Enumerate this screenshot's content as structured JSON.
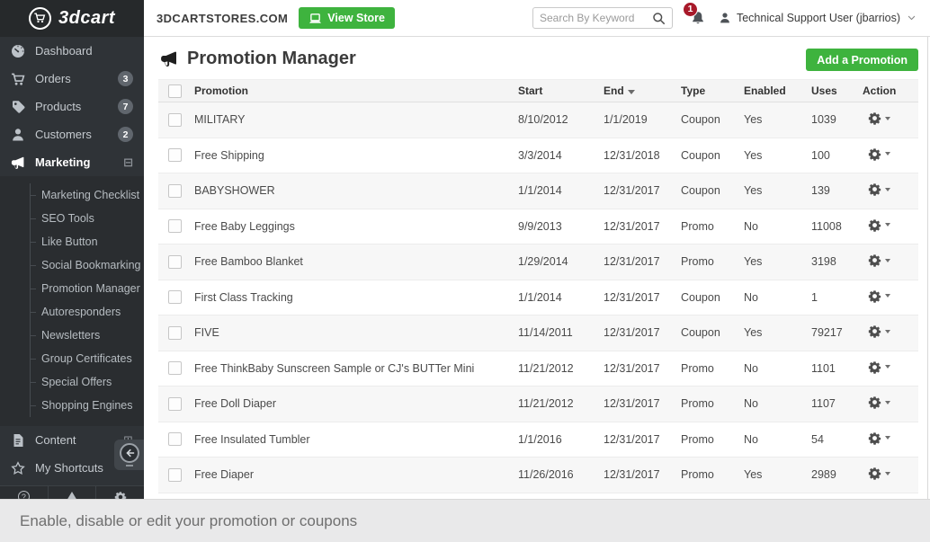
{
  "topbar": {
    "logo_text": "3dcart",
    "store_domain": "3DCARTSTORES.COM",
    "view_store_label": "View Store",
    "search_placeholder": "Search By Keyword",
    "notification_count": "1",
    "user_name": "Technical Support User (jbarrios)"
  },
  "sidebar": {
    "items_top": [
      {
        "label": "Dashboard",
        "icon": "gauge-icon"
      },
      {
        "label": "Orders",
        "icon": "cart-icon",
        "badge": "3"
      },
      {
        "label": "Products",
        "icon": "tags-icon",
        "badge": "7"
      },
      {
        "label": "Customers",
        "icon": "person-icon",
        "badge": "2"
      },
      {
        "label": "Marketing",
        "icon": "megaphone-icon",
        "active": true,
        "expander": "collapse"
      }
    ],
    "submenu": [
      {
        "label": "Marketing Checklist"
      },
      {
        "label": "SEO Tools"
      },
      {
        "label": "Like Button"
      },
      {
        "label": "Social Bookmarking"
      },
      {
        "label": "Promotion Manager"
      },
      {
        "label": "Autoresponders"
      },
      {
        "label": "Newsletters"
      },
      {
        "label": "Group Certificates"
      },
      {
        "label": "Special Offers"
      },
      {
        "label": "Shopping Engines"
      }
    ],
    "items_bottom": [
      {
        "label": "Content",
        "icon": "document-icon",
        "expander": "expand"
      },
      {
        "label": "My Shortcuts",
        "icon": "star-icon"
      }
    ]
  },
  "page": {
    "title": "Promotion Manager",
    "add_promotion_label": "Add a Promotion"
  },
  "table": {
    "columns": [
      "Promotion",
      "Start",
      "End",
      "Type",
      "Enabled",
      "Uses",
      "Action"
    ],
    "sorted_column": "End",
    "sort_direction": "desc",
    "rows": [
      {
        "name": "MILITARY",
        "start": "8/10/2012",
        "end": "1/1/2019",
        "type": "Coupon",
        "enabled": "Yes",
        "uses": "1039"
      },
      {
        "name": "Free Shipping",
        "start": "3/3/2014",
        "end": "12/31/2018",
        "type": "Coupon",
        "enabled": "Yes",
        "uses": "100"
      },
      {
        "name": "BABYSHOWER",
        "start": "1/1/2014",
        "end": "12/31/2017",
        "type": "Coupon",
        "enabled": "Yes",
        "uses": "139"
      },
      {
        "name": "Free Baby Leggings",
        "start": "9/9/2013",
        "end": "12/31/2017",
        "type": "Promo",
        "enabled": "No",
        "uses": "11008"
      },
      {
        "name": "Free Bamboo Blanket",
        "start": "1/29/2014",
        "end": "12/31/2017",
        "type": "Promo",
        "enabled": "Yes",
        "uses": "3198"
      },
      {
        "name": "First Class Tracking",
        "start": "1/1/2014",
        "end": "12/31/2017",
        "type": "Coupon",
        "enabled": "No",
        "uses": "1"
      },
      {
        "name": "FIVE",
        "start": "11/14/2011",
        "end": "12/31/2017",
        "type": "Coupon",
        "enabled": "Yes",
        "uses": "79217"
      },
      {
        "name": "Free ThinkBaby Sunscreen Sample or CJ's BUTTer Mini",
        "start": "11/21/2012",
        "end": "12/31/2017",
        "type": "Promo",
        "enabled": "No",
        "uses": "1101"
      },
      {
        "name": "Free Doll Diaper",
        "start": "11/21/2012",
        "end": "12/31/2017",
        "type": "Promo",
        "enabled": "No",
        "uses": "1107"
      },
      {
        "name": "Free Insulated Tumbler",
        "start": "1/1/2016",
        "end": "12/31/2017",
        "type": "Promo",
        "enabled": "No",
        "uses": "54"
      },
      {
        "name": "Free Diaper",
        "start": "11/26/2016",
        "end": "12/31/2017",
        "type": "Promo",
        "enabled": "Yes",
        "uses": "2989"
      }
    ]
  },
  "statusbar": {
    "text": "Enable, disable or edit your promotion or coupons"
  },
  "colors": {
    "accent_green": "#3eb33e",
    "notification_red": "#a8192a",
    "sidebar_bg": "#2f3337",
    "submenu_bg": "#2a2d30",
    "statusbar_bg": "#e9e9ea"
  }
}
